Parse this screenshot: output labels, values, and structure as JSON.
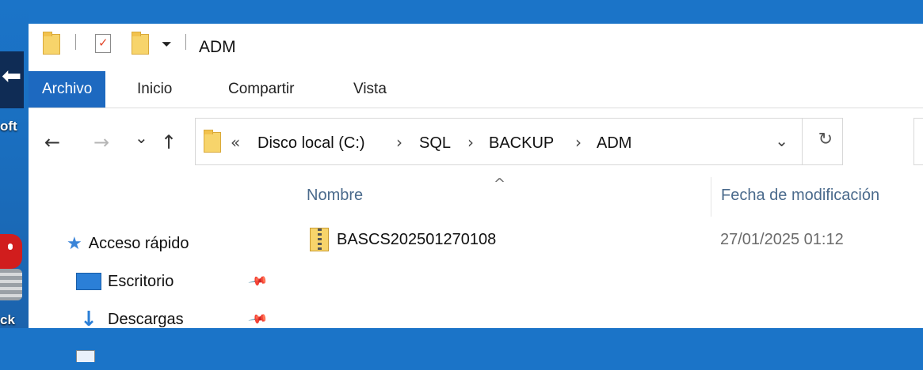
{
  "desktop": {
    "label_top": "oft",
    "label_bottom": "ck"
  },
  "window": {
    "title": "ADM"
  },
  "ribbon": {
    "tabs": [
      "Archivo",
      "Inicio",
      "Compartir",
      "Vista"
    ]
  },
  "navigation": {
    "back": "←",
    "forward": "→",
    "recent": "⌄",
    "up": "↑",
    "breadcrumb_overflow": "«",
    "path": [
      "Disco local (C:)",
      "SQL",
      "BACKUP",
      "ADM"
    ],
    "separator": "›",
    "dropdown": "⌄",
    "refresh": "↻"
  },
  "nav_pane": {
    "items": [
      {
        "label": "Acceso rápido",
        "icon": "star-icon"
      },
      {
        "label": "Escritorio",
        "icon": "desktop-icon",
        "pinned": true
      },
      {
        "label": "Descargas",
        "icon": "download-icon",
        "pinned": true
      }
    ]
  },
  "file_list": {
    "columns": [
      "Nombre",
      "Fecha de modificación"
    ],
    "sort_indicator": "^",
    "rows": [
      {
        "name": "BASCS202501270108",
        "modified": "27/01/2025 01:12",
        "icon": "zip-folder-icon"
      }
    ]
  },
  "colors": {
    "accent": "#1d69c0",
    "desktop_bg": "#1b74c8",
    "folder": "#f7d46b"
  }
}
